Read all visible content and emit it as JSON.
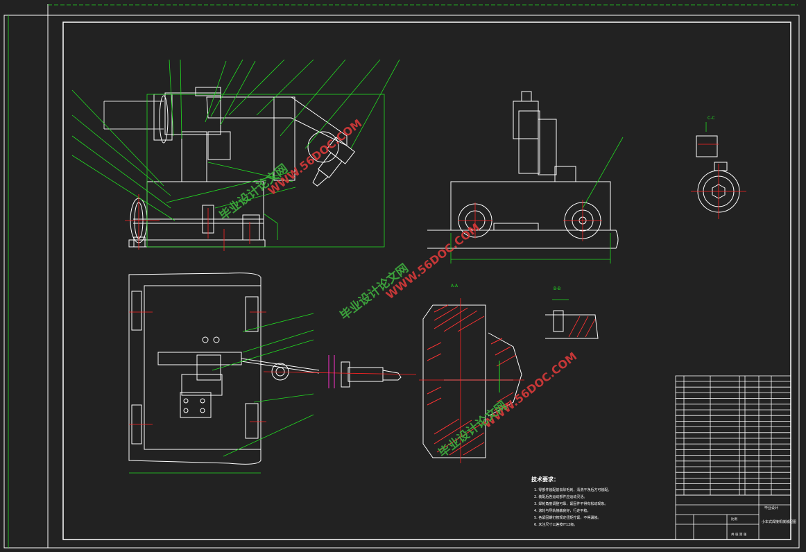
{
  "colors": {
    "background": "#222222",
    "frame": "#ffffff",
    "part_line": "#ffffff",
    "leader": "#22dd22",
    "dimension": "#dddddd",
    "center_line": "#ff2222",
    "hatch": "#ff3333",
    "accent_magenta": "#ff33cc",
    "watermark_green": "#3fae3f",
    "watermark_red": "#d63a3a"
  },
  "watermarks": {
    "site_cn": "毕业设计论文网",
    "site_url": "WWW.56DOC.COM"
  },
  "notes": {
    "title": "技术要求：",
    "items": [
      "1. 零部件装配前去除毛刺，清洗干净后方可装配。",
      "2. 装配后各运动部件应运动灵活。",
      "3. 焊枪角度调整可靠，紧固件不得有松动现象。",
      "4. 滚轮与导轨接触良好，行走平稳。",
      "5. 各紧固螺钉按规定扭矩拧紧，不得漏装。",
      "6. 未注尺寸公差按IT12级。"
    ]
  },
  "title_block": {
    "drawing_name": "小车式焊接机械装配图",
    "company": "毕业设计",
    "scale_label": "比例",
    "sheet_label": "共 张 第 张"
  },
  "section_labels": {
    "a": "A-A",
    "b": "B-B",
    "c": "C-C"
  }
}
